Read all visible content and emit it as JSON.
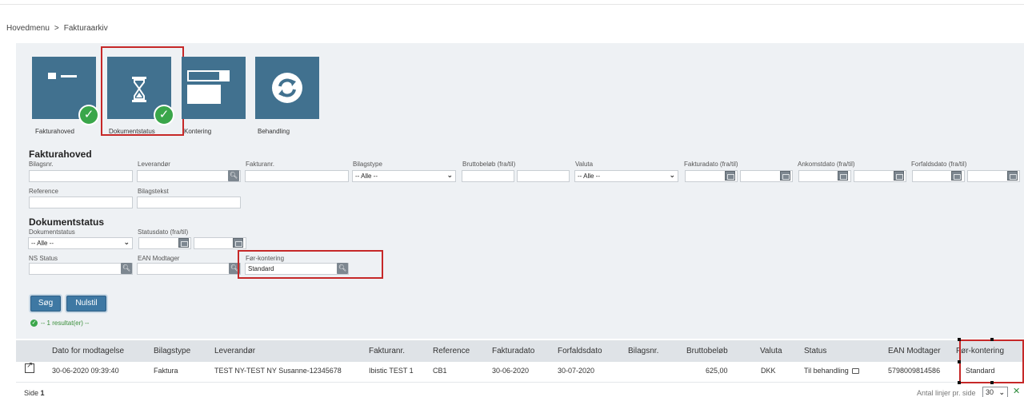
{
  "breadcrumb": {
    "home": "Hovedmenu",
    "separator": ">",
    "current": "Fakturaarkiv"
  },
  "tiles": [
    {
      "label": "Fakturahoved",
      "icon": "header-icon",
      "checked": true
    },
    {
      "label": "Dokumentstatus",
      "icon": "hourglass-icon",
      "checked": true
    },
    {
      "label": "Kontering",
      "icon": "posting-icon",
      "checked": false
    },
    {
      "label": "Behandling",
      "icon": "refresh-icon",
      "checked": false
    }
  ],
  "fakturahoved": {
    "title": "Fakturahoved",
    "bilagsnr_label": "Bilagsnr.",
    "leverandor_label": "Leverandør",
    "fakturanr_label": "Fakturanr.",
    "bilagstype_label": "Bilagstype",
    "bilagstype_value": "-- Alle --",
    "bruttobelob_label": "Bruttobeløb (fra/til)",
    "valuta_label": "Valuta",
    "valuta_value": "-- Alle --",
    "fakturadato_label": "Fakturadato (fra/til)",
    "ankomstdato_label": "Ankomstdato (fra/til)",
    "forfaldsdato_label": "Forfaldsdato (fra/til)",
    "reference_label": "Reference",
    "bilagstekst_label": "Bilagstekst"
  },
  "dokumentstatus": {
    "title": "Dokumentstatus",
    "dokumentstatus_label": "Dokumentstatus",
    "dokumentstatus_value": "-- Alle --",
    "statusdato_label": "Statusdato (fra/til)",
    "ns_status_label": "NS Status",
    "ean_label": "EAN Modtager",
    "forkontering_label": "Før-kontering",
    "forkontering_value": "Standard"
  },
  "buttons": {
    "search": "Søg",
    "reset": "Nulstil"
  },
  "result_text": "-- 1 resultat(er) --",
  "table": {
    "headers": [
      "Dato for modtagelse",
      "Bilagstype",
      "Leverandør",
      "Fakturanr.",
      "Reference",
      "Fakturadato",
      "Forfaldsdato",
      "Bilagsnr.",
      "Bruttobeløb",
      "Valuta",
      "Status",
      "EAN Modtager",
      "Før-kontering"
    ],
    "rows": [
      [
        "30-06-2020 09:39:40",
        "Faktura",
        "TEST NY-TEST NY Susanne-12345678",
        "Ibistic TEST 1",
        "CB1",
        "30-06-2020",
        "30-07-2020",
        "",
        "625,00",
        "DKK",
        "Til behandling",
        "5798009814586",
        "Standard"
      ]
    ]
  },
  "footer": {
    "page_label": "Side",
    "page_number": "1",
    "rows_per_page_label": "Antal linjer pr. side",
    "rows_per_page_value": "30"
  },
  "colors": {
    "tile": "#41718f",
    "check": "#3aa64a",
    "highlight": "#c62828",
    "button": "#3e78a3"
  }
}
